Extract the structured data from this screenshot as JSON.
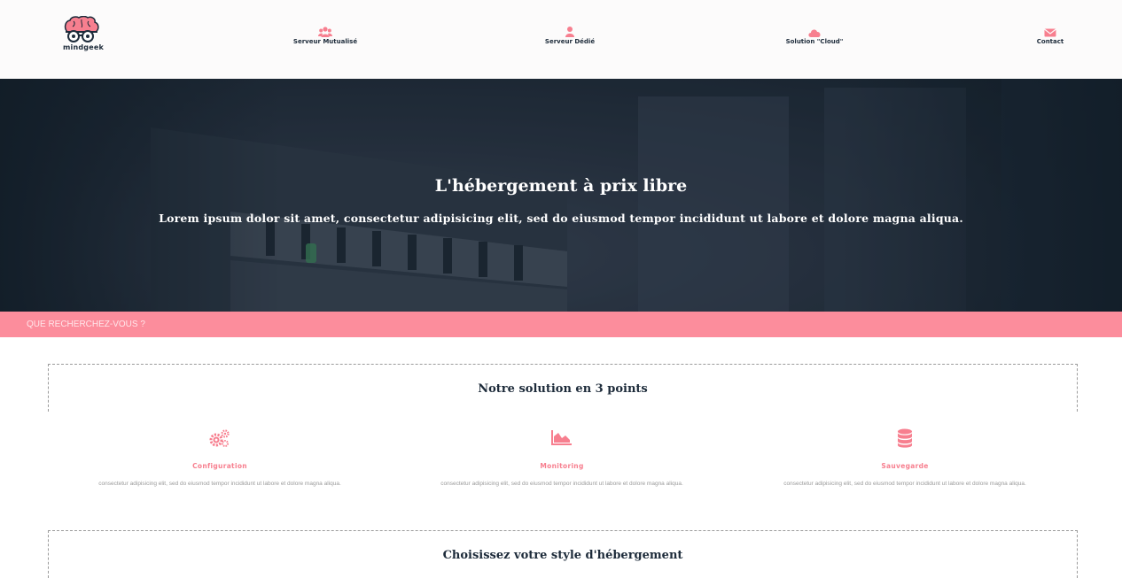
{
  "header": {
    "logo_text": "mindgeek",
    "nav": [
      {
        "label": "Serveur Mutualisé",
        "icon": "users-icon"
      },
      {
        "label": "Serveur Dédié",
        "icon": "user-icon"
      },
      {
        "label": "Solution \"Cloud\"",
        "icon": "cloud-icon"
      },
      {
        "label": "Contact",
        "icon": "envelope-icon"
      }
    ]
  },
  "hero": {
    "title": "L'hébergement à prix libre",
    "subtitle": "Lorem ipsum dolor sit amet, consectetur adipisicing elit, sed do eiusmod tempor incididunt ut labore et dolore magna aliqua."
  },
  "search": {
    "placeholder": "QUE RECHERCHEZ-VOUS ?"
  },
  "features_section": {
    "title": "Notre solution en 3 points",
    "items": [
      {
        "title": "Configuration",
        "icon": "gears-icon",
        "description": "consectetur adipisicing elit, sed do eiusmod tempor incididunt ut labore et dolore magna aliqua."
      },
      {
        "title": "Monitoring",
        "icon": "area-chart-icon",
        "description": "consectetur adipisicing elit, sed do eiusmod tempor incididunt ut labore et dolore magna aliqua."
      },
      {
        "title": "Sauvegarde",
        "icon": "database-icon",
        "description": "consectetur adipisicing elit, sed do eiusmod tempor incididunt ut labore et dolore magna aliqua."
      }
    ]
  },
  "hosting_section": {
    "title": "Choisissez votre style d'hébergement"
  },
  "colors": {
    "accent": "#fc8d9c",
    "dark": "#1d2b3a",
    "header_bg": "#fcfbfb"
  }
}
